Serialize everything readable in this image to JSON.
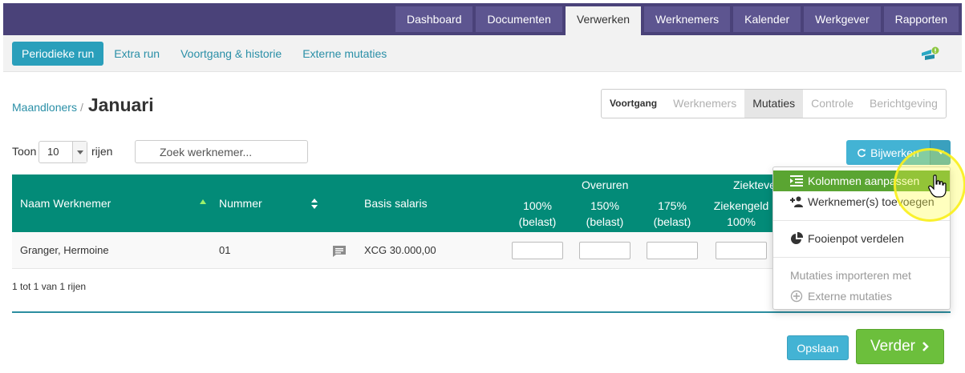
{
  "top_nav": {
    "tabs": [
      {
        "label": "Dashboard",
        "active": false
      },
      {
        "label": "Documenten",
        "active": false
      },
      {
        "label": "Verwerken",
        "active": true
      },
      {
        "label": "Werknemers",
        "active": false
      },
      {
        "label": "Kalender",
        "active": false
      },
      {
        "label": "Werkgever",
        "active": false
      },
      {
        "label": "Rapporten",
        "active": false
      }
    ]
  },
  "sub_nav": {
    "items": [
      {
        "label": "Periodieke run",
        "active": true
      },
      {
        "label": "Extra run",
        "active": false
      },
      {
        "label": "Voortgang & historie",
        "active": false
      },
      {
        "label": "Externe mutaties",
        "active": false
      }
    ]
  },
  "breadcrumb": {
    "parent": "Maandloners",
    "separator": "/",
    "title": "Januari"
  },
  "steps": {
    "items": [
      {
        "label": "Voortgang",
        "state": "label"
      },
      {
        "label": "Werknemers",
        "state": "disabled"
      },
      {
        "label": "Mutaties",
        "state": "current"
      },
      {
        "label": "Controle",
        "state": "disabled"
      },
      {
        "label": "Berichtgeving",
        "state": "disabled"
      }
    ]
  },
  "controls": {
    "show_label": "Toon",
    "page_size": "10",
    "rows_label": "rijen",
    "search_placeholder": "Zoek werknemer...",
    "update_button": "Bijwerken"
  },
  "table": {
    "group_headers": {
      "overtime": "Overuren",
      "sick": "Ziekteve"
    },
    "columns": {
      "name": "Naam Werknemer",
      "number": "Nummer",
      "salary": "Basis salaris",
      "ot100": [
        "100%",
        "(belast)"
      ],
      "ot150": [
        "150%",
        "(belast)"
      ],
      "ot175": [
        "175%",
        "(belast)"
      ],
      "sick": [
        "Ziekengeld",
        "100%"
      ]
    },
    "rows": [
      {
        "name": "Granger, Hermoine",
        "number": "01",
        "salary": "XCG 30.000,00"
      }
    ],
    "info": "1 tot 1 van 1 rijen"
  },
  "dropdown": {
    "items": [
      {
        "label": "Kolommen aanpassen",
        "icon": "columns-icon",
        "active": true
      },
      {
        "label": "Werknemer(s) toevoegen",
        "icon": "add-user-icon"
      },
      {
        "label": "Fooienpot verdelen",
        "icon": "pie-chart-icon"
      },
      {
        "label": "Mutaties importeren met",
        "disabled": true
      },
      {
        "label": "Externe mutaties",
        "icon": "external-icon",
        "disabled": true
      }
    ]
  },
  "footer": {
    "save_label": "Opslaan",
    "next_label": "Verder"
  },
  "colors": {
    "top_nav": "#4a4279",
    "top_tab": "#5d5590",
    "table_header": "#038b78",
    "primary_blue": "#43b3d4",
    "active_green": "#5aa532",
    "next_green": "#6cbf3c",
    "link": "#2a8fa7"
  }
}
